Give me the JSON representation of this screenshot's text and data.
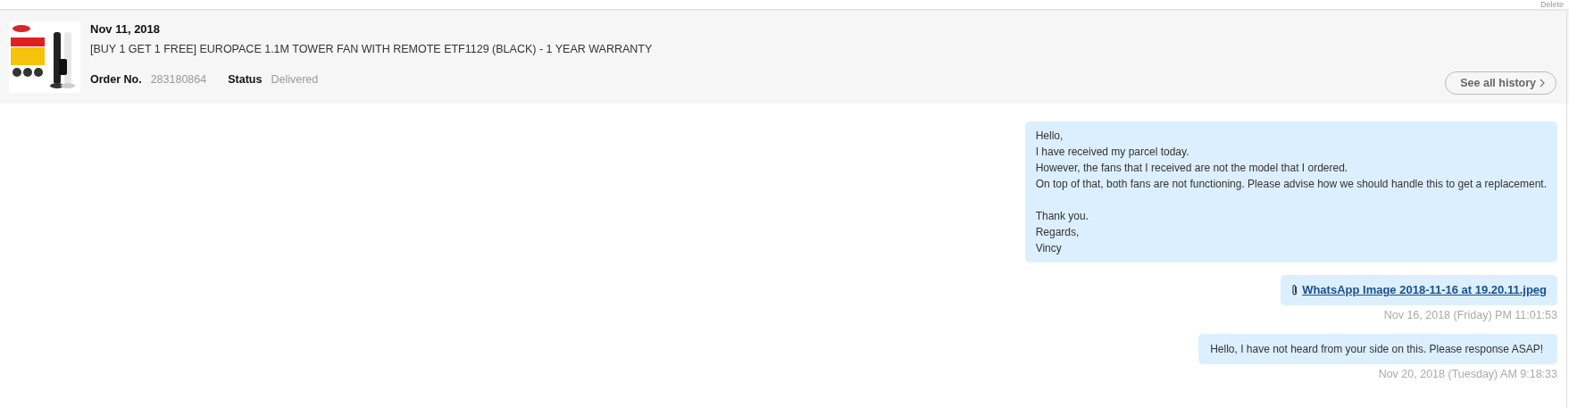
{
  "top_action": "Delete",
  "order": {
    "date": "Nov 11, 2018",
    "title": "[BUY 1 GET 1 FREE] EUROPACE 1.1M TOWER FAN WITH REMOTE ETF1129 (BLACK) - 1 YEAR WARRANTY",
    "order_label": "Order No.",
    "order_no": "283180864",
    "status_label": "Status",
    "status": "Delivered",
    "history_button": "See all history"
  },
  "messages": [
    {
      "kind": "text",
      "paragraphs": [
        [
          "Hello,",
          "I have received my parcel today.",
          "However, the fans that I received are not the model that I ordered.",
          "On top of that, both fans are not functioning. Please advise how we should handle this to get a replacement."
        ],
        [
          "Thank you.",
          "Regards,",
          "Vincy"
        ]
      ]
    },
    {
      "kind": "attachment",
      "file": "WhatsApp Image 2018-11-16 at 19.20.11.jpeg",
      "time": "Nov 16, 2018 (Friday) PM 11:01:53"
    },
    {
      "kind": "text",
      "paragraphs": [
        [
          "Hello, I have not heard from your side on this. Please response ASAP!"
        ]
      ],
      "time": "Nov 20, 2018 (Tuesday) AM 9:18:33"
    }
  ]
}
